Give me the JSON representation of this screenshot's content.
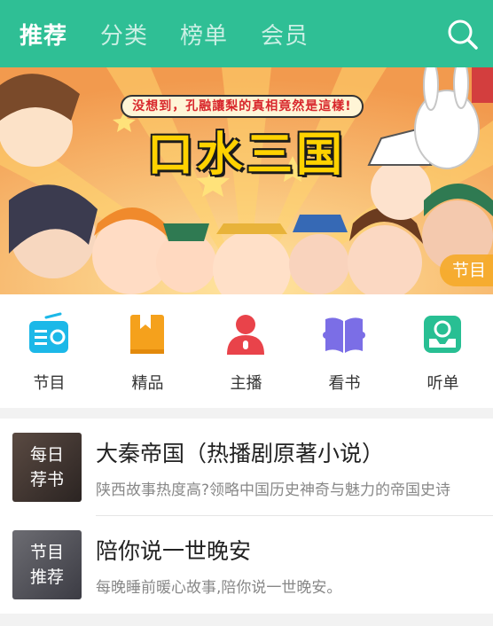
{
  "header": {
    "tabs": [
      {
        "label": "推荐",
        "active": true
      },
      {
        "label": "分类",
        "active": false
      },
      {
        "label": "榜单",
        "active": false
      },
      {
        "label": "会员",
        "active": false
      }
    ],
    "search_icon": "search-icon",
    "color": "#2fbf95"
  },
  "banner": {
    "headline": "没想到，孔融讓梨的真相竟然是這樣!",
    "logo": "口水三国",
    "tag": "节目"
  },
  "nav": {
    "items": [
      {
        "label": "节目",
        "icon": "radio-icon",
        "color": "#1cb8e8"
      },
      {
        "label": "精品",
        "icon": "bookmark-book-icon",
        "color": "#f5a11c"
      },
      {
        "label": "主播",
        "icon": "anchor-person-icon",
        "color": "#e9434a"
      },
      {
        "label": "看书",
        "icon": "open-book-icon",
        "color": "#7b6ee6"
      },
      {
        "label": "听单",
        "icon": "playlist-tray-icon",
        "color": "#28bf93"
      }
    ]
  },
  "list": {
    "items": [
      {
        "thumb_line1": "每日",
        "thumb_line2": "荐书",
        "title": "大秦帝国（热播剧原著小说）",
        "desc": "陕西故事热度高?领略中国历史神奇与魅力的帝国史诗"
      },
      {
        "thumb_line1": "节目",
        "thumb_line2": "推荐",
        "title": "陪你说一世晚安",
        "desc": "每晚睡前暖心故事,陪你说一世晚安。"
      }
    ]
  }
}
